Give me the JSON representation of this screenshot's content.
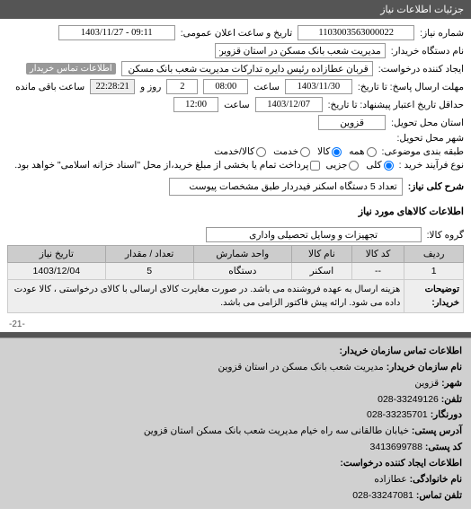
{
  "header": {
    "title": "جزئیات اطلاعات نیاز"
  },
  "fields": {
    "req_no_label": "شماره نیاز:",
    "req_no": "1103003563000022",
    "pub_date_label": "تاریخ و ساعت اعلان عمومی:",
    "pub_date": "09:11 - 1403/11/27",
    "buyer_org_label": "نام دستگاه خریدار:",
    "buyer_org": "مدیریت شعب بانک مسکن در استان قزوین",
    "requester_label": "ایجاد کننده درخواست:",
    "requester": "قربان عطازاده رئیس دایره تدارکات مدیریت شعب بانک مسکن در استان قزوین",
    "contact_badge": "اطلاعات تماس خریدار",
    "deadline_label": "مهلت ارسال پاسخ: تا تاریخ:",
    "deadline_date": "1403/11/30",
    "time_label": "ساعت",
    "deadline_time": "08:00",
    "day_label": "روز و",
    "days": "2",
    "remaining": "22:28:21",
    "remaining_label": "ساعت باقی مانده",
    "min_date_label": "حداقل تاریخ اعتبار پیشنهاد: تا تاریخ:",
    "min_date": "1403/12/07",
    "min_time": "12:00",
    "delivery_state_label": "استان محل تحویل:",
    "delivery_state": "قزوین",
    "delivery_city_label": "شهر محل تحویل:",
    "subject_cat_label": "طبقه بندی موضوعی:",
    "radio_all": "همه",
    "radio_goods": "کالا",
    "radio_service": "خدمت",
    "radio_goods_service": "کالا/خدمت",
    "purchase_type_label": "نوع فرآیند خرید :",
    "radio_total": "کلی",
    "radio_partial": "جزیی",
    "purchase_note": "پرداخت تمام یا بخشی از مبلغ خرید،از محل \"اسناد خزانه اسلامی\" خواهد بود.",
    "desc_label": "شرح کلی نیاز:",
    "desc": "تعداد 5 دستگاه اسکنر فیدردار طبق مشخصات پیوست"
  },
  "goods": {
    "title": "اطلاعات کالاهای مورد نیاز",
    "group_label": "گروه کالا:",
    "group": "تجهیزات و وسایل تحصیلی واداری",
    "headers": {
      "row": "ردیف",
      "code": "کد کالا",
      "name": "نام کالا",
      "unit": "واحد شمارش",
      "qty": "تعداد / مقدار",
      "date": "تاریخ نیاز"
    },
    "items": [
      {
        "row": "1",
        "code": "--",
        "name": "اسکنر",
        "unit": "دستگاه",
        "qty": "5",
        "date": "1403/12/04"
      }
    ],
    "note_label": "توضیحات خریدار:",
    "note": "هزینه ارسال به عهده فروشنده می باشد. در صورت مغایرت کالای ارسالی با کالای درخواستی ، کالا عودت داده می شود. ارائه پیش فاکتور الزامی می باشد."
  },
  "page": "-21-",
  "contact": {
    "title": "اطلاعات تماس سازمان خریدار:",
    "org_label": "نام سازمان خریدار:",
    "org": "مدیریت شعب بانک مسکن در استان قزوین",
    "city_label": "شهر:",
    "city": "قزوین",
    "tel_label": "تلفن:",
    "tel": "33249126-028",
    "fax_label": "دورنگار:",
    "fax": "33235701-028",
    "addr_label": "آدرس پستی:",
    "addr": "خیابان طالقانی سه راه خیام مدیریت شعب بانک مسکن استان قزوین",
    "postcode_label": "کد پستی:",
    "postcode": "3413699788",
    "req_contact_title": "اطلاعات ایجاد کننده درخواست:",
    "family_label": "نام خانوادگی:",
    "family": "عطازاده",
    "tel2_label": "تلفن تماس:",
    "tel2": "33247081-028"
  }
}
